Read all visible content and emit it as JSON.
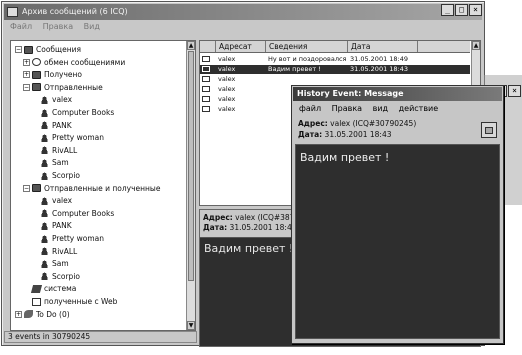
{
  "main_window": {
    "title": "Архив сообщений (6 ICQ)",
    "menu": [
      "Файл",
      "Правка",
      "Вид"
    ],
    "controls": [
      "_",
      "□",
      "×"
    ]
  },
  "tree": {
    "items": [
      {
        "label": "Сообщения",
        "icon": "messages-icon",
        "expander": "−"
      },
      {
        "label": "обмен сообщениями",
        "icon": "chat-icon",
        "expander": "+"
      },
      {
        "label": "Получено",
        "icon": "received-folder-icon",
        "expander": "+"
      },
      {
        "label": "Отправленные",
        "icon": "sent-folder-icon",
        "expander": "−"
      },
      {
        "label": "valex",
        "icon": "contact-icon",
        "expander": ""
      },
      {
        "label": "Computer Books",
        "icon": "contact-icon",
        "expander": ""
      },
      {
        "label": "PANK",
        "icon": "contact-icon",
        "expander": ""
      },
      {
        "label": "Pretty woman",
        "icon": "contact-icon",
        "expander": ""
      },
      {
        "label": "RivALL",
        "icon": "contact-icon",
        "expander": ""
      },
      {
        "label": "Sam",
        "icon": "contact-icon",
        "expander": ""
      },
      {
        "label": "Scorpio",
        "icon": "contact-icon",
        "expander": ""
      },
      {
        "label": "Отправленные и полученные",
        "icon": "sent-received-folder-icon",
        "expander": "−"
      },
      {
        "label": "valex",
        "icon": "contact-icon",
        "expander": ""
      },
      {
        "label": "Computer Books",
        "icon": "contact-icon",
        "expander": ""
      },
      {
        "label": "PANK",
        "icon": "contact-icon",
        "expander": ""
      },
      {
        "label": "Pretty woman",
        "icon": "contact-icon",
        "expander": ""
      },
      {
        "label": "RivALL",
        "icon": "contact-icon",
        "expander": ""
      },
      {
        "label": "Sam",
        "icon": "contact-icon",
        "expander": ""
      },
      {
        "label": "Scorpio",
        "icon": "contact-icon",
        "expander": ""
      },
      {
        "label": "система",
        "icon": "system-icon",
        "expander": ""
      },
      {
        "label": "полученные с Web",
        "icon": "web-icon",
        "expander": ""
      },
      {
        "label": "To Do (0)",
        "icon": "todo-icon",
        "expander": "+"
      }
    ]
  },
  "status": "3 events in 30790245",
  "message_list": {
    "columns": [
      "Адресат",
      "Сведения",
      "Дата"
    ],
    "rows": [
      {
        "to": "valex",
        "info": "Ну вот и поздоровался",
        "date": "31.05.2001 18:49",
        "selected": false
      },
      {
        "to": "valex",
        "info": "Вадим превет !",
        "date": "31.05.2001 18:43",
        "selected": true
      },
      {
        "to": "valex",
        "info": "",
        "date": "",
        "selected": false
      },
      {
        "to": "valex",
        "info": "",
        "date": "",
        "selected": false
      },
      {
        "to": "valex",
        "info": "",
        "date": "",
        "selected": false
      },
      {
        "to": "valex",
        "info": "",
        "date": "",
        "selected": false
      }
    ]
  },
  "preview": {
    "address_label": "Адрес:",
    "address_value": "valex (ICQ#3871",
    "date_label": "Дата:",
    "date_value": "31.05.2001 18:4",
    "body": "Вадим превет !"
  },
  "history_window": {
    "title": "History Event: Message",
    "menu": [
      "файл",
      "Правка",
      "вид",
      "действие"
    ],
    "address_label": "Адрес:",
    "address_value": "valex (ICQ#30790245)",
    "date_label": "Дата:",
    "date_value": "31.05.2001 18:43",
    "body": "Вадим превет !"
  },
  "bg_window_controls": [
    "_",
    "□",
    "×"
  ]
}
